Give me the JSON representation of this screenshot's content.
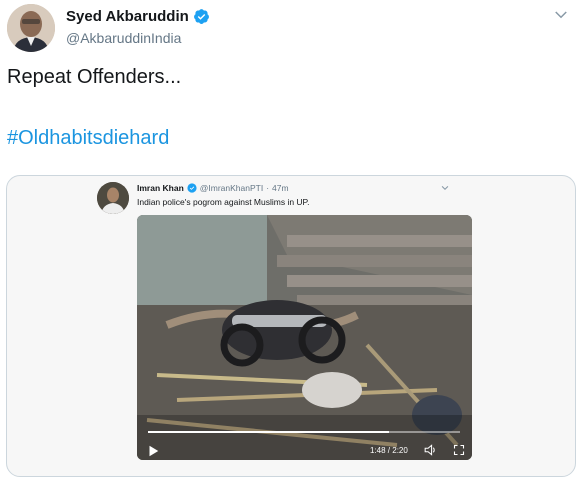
{
  "tweet": {
    "author_name": "Syed Akbaruddin",
    "author_handle": "@AkbaruddinIndia",
    "text": "Repeat Offenders...",
    "hashtag": "#Oldhabitsdiehard"
  },
  "quoted_tweet": {
    "author_name": "Imran Khan",
    "author_handle": "@ImranKhanPTI",
    "separator": "·",
    "time": "47m",
    "text": "Indian police's pogrom against Muslims in UP."
  },
  "video": {
    "timestamp": "1:48 / 2:20",
    "progress_fraction": 0.771
  },
  "icons": {
    "verified": "verified-badge-icon",
    "menu": "chevron-down-icon",
    "play": "play-icon",
    "volume": "volume-icon",
    "fullscreen": "fullscreen-icon"
  },
  "colors": {
    "link": "#1b95e0",
    "verified": "#1da1f2",
    "secondary_text": "#657786",
    "border": "#ccd6dd"
  }
}
